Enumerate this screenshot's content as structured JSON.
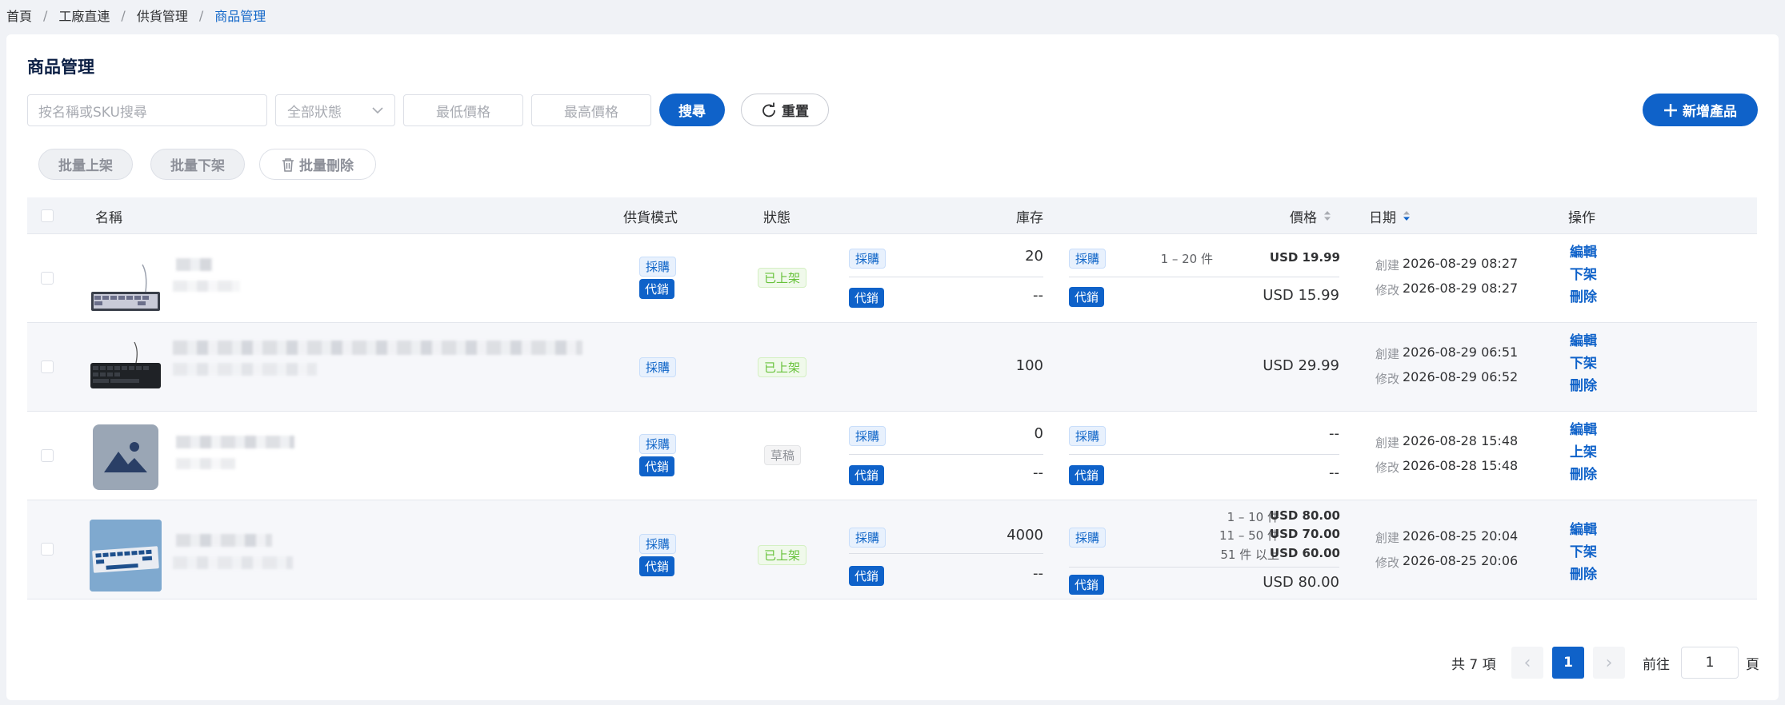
{
  "breadcrumb": {
    "items": [
      "首頁",
      "工廠直連",
      "供貨管理"
    ],
    "current": "商品管理",
    "sep": "/"
  },
  "page": {
    "title": "商品管理"
  },
  "filters": {
    "search_placeholder": "按名稱或SKU搜尋",
    "status_placeholder": "全部狀態",
    "min_price_placeholder": "最低價格",
    "max_price_placeholder": "最高價格",
    "search_label": "搜尋",
    "reset_label": "重置",
    "add_label": "新增產品"
  },
  "bulk": {
    "list_label": "批量上架",
    "unlist_label": "批量下架",
    "delete_label": "批量刪除"
  },
  "columns": {
    "name": "名稱",
    "mode": "供貨模式",
    "status": "狀態",
    "stock": "庫存",
    "price": "價格",
    "date": "日期",
    "ops": "操作"
  },
  "tags": {
    "purchase": "採購",
    "consign": "代銷",
    "listed": "已上架",
    "draft": "草稿"
  },
  "labels": {
    "created": "創建",
    "modified": "修改",
    "edit": "編輯",
    "unlist": "下架",
    "list": "上架",
    "delete": "刪除"
  },
  "rows": [
    {
      "stock_purchase": "20",
      "stock_consign": "--",
      "tier1_range": "1 – 20 件",
      "tier1_price": "USD 19.99",
      "consign_price": "USD 15.99",
      "created": "2026-08-29 08:27",
      "modified": "2026-08-29 08:27"
    },
    {
      "stock": "100",
      "price": "USD 29.99",
      "created": "2026-08-29 06:51",
      "modified": "2026-08-29 06:52"
    },
    {
      "stock_purchase": "0",
      "stock_consign": "--",
      "purchase_price": "--",
      "consign_price": "--",
      "created": "2026-08-28 15:48",
      "modified": "2026-08-28 15:48"
    },
    {
      "stock_purchase": "4000",
      "stock_consign": "--",
      "tier1_range": "1 – 10 件",
      "tier1_price": "USD 80.00",
      "tier2_range": "11 – 50 件",
      "tier2_price": "USD 70.00",
      "tier3_range": "51 件 以上",
      "tier3_price": "USD 60.00",
      "consign_price": "USD 80.00",
      "created": "2026-08-25 20:04",
      "modified": "2026-08-25 20:06"
    }
  ],
  "pagination": {
    "total": "共 7 項",
    "current": "1",
    "goto_prefix": "前往",
    "goto_value": "1",
    "goto_suffix": "頁"
  },
  "icons": {
    "chevron_left": "‹",
    "chevron_right": "›",
    "chevron_down": "⌄",
    "sort": "▲▼"
  },
  "colors": {
    "primary": "#0f62c9",
    "success": "#67c23a",
    "background": "#f0f2f6"
  }
}
